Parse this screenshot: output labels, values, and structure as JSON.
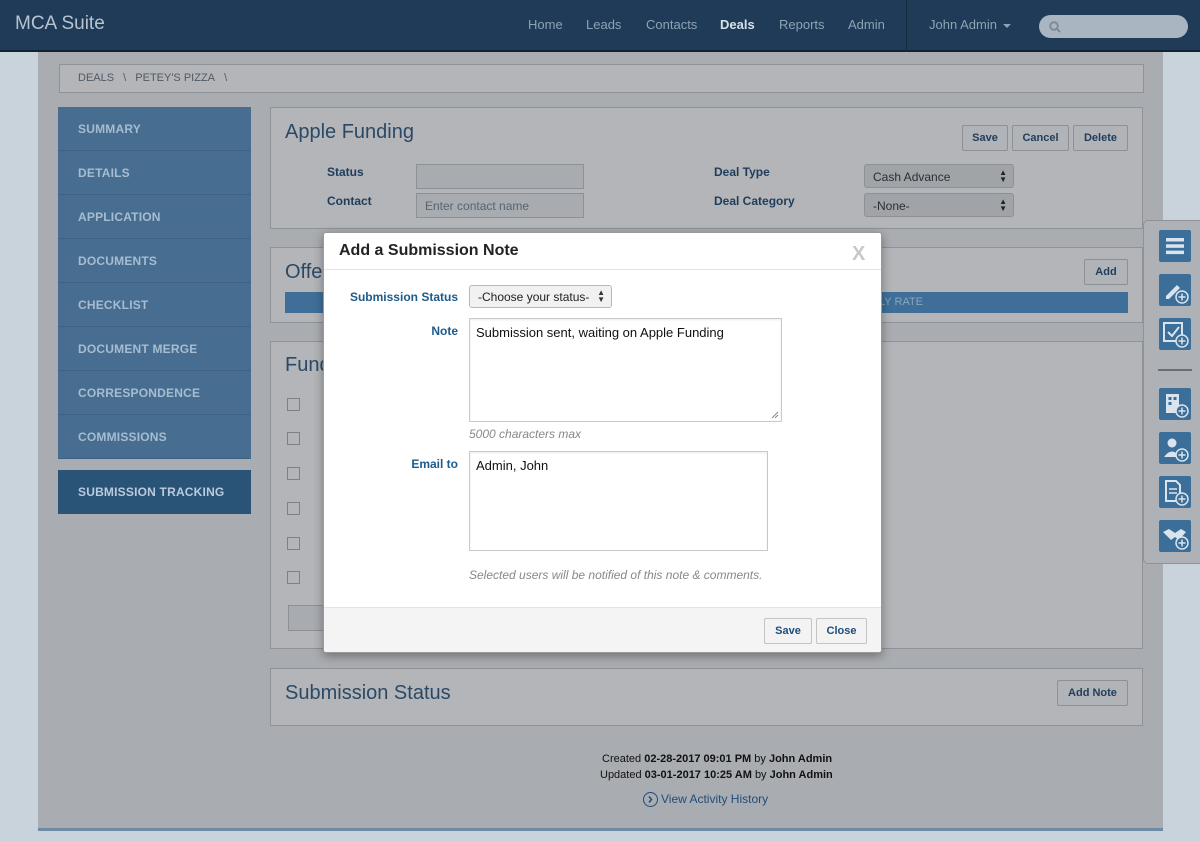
{
  "app": {
    "title": "MCA Suite"
  },
  "nav": {
    "items": [
      "Home",
      "Leads",
      "Contacts",
      "Deals",
      "Reports",
      "Admin"
    ],
    "active": "Deals",
    "user": "John Admin"
  },
  "breadcrumb": [
    "DEALS",
    "\\",
    "PETEY'S PIZZA",
    "\\"
  ],
  "sidebar": {
    "items": [
      "SUMMARY",
      "DETAILS",
      "APPLICATION",
      "DOCUMENTS",
      "CHECKLIST",
      "DOCUMENT MERGE",
      "CORRESPONDENCE",
      "COMMISSIONS"
    ],
    "tracking": "SUBMISSION TRACKING"
  },
  "deal": {
    "title": "Apple Funding",
    "buttons": {
      "save": "Save",
      "cancel": "Cancel",
      "delete": "Delete"
    },
    "status_label": "Status",
    "status_value": "",
    "contact_label": "Contact",
    "contact_placeholder": "Enter contact name",
    "deal_type_label": "Deal Type",
    "deal_type_value": "Cash Advance",
    "deal_category_label": "Deal Category",
    "deal_category_value": "-None-"
  },
  "offers": {
    "title_partial": "Offe",
    "add": "Add",
    "column_partial": "LY RATE"
  },
  "funders": {
    "title_partial": "Fund"
  },
  "submission_status": {
    "title": "Submission Status",
    "add_note": "Add Note"
  },
  "meta": {
    "created_prefix": "Created",
    "created_date": "02-28-2017 09:01 PM",
    "created_by_word": "by",
    "created_by": "John Admin",
    "updated_prefix": "Updated",
    "updated_date": "03-01-2017 10:25 AM",
    "updated_by_word": "by",
    "updated_by": "John Admin",
    "history_link": "View Activity History"
  },
  "modal": {
    "title": "Add a Submission Note",
    "close_x": "X",
    "status_label": "Submission Status",
    "status_value": "-Choose your status-",
    "note_label": "Note",
    "note_value": "Submission sent, waiting on Apple Funding",
    "note_hint": "5000 characters max",
    "email_label": "Email to",
    "email_value": "Admin, John",
    "email_hint": "Selected users will be notified of this note & comments.",
    "save": "Save",
    "close": "Close"
  },
  "rail": {
    "icons": [
      "menu-icon",
      "edit-add-icon",
      "checklist-add-icon",
      "building-add-icon",
      "user-add-icon",
      "document-add-icon",
      "handshake-add-icon"
    ]
  },
  "colors": {
    "navbar": "#1f3b57",
    "sidebar": "#476e91",
    "accent": "#1e4d7b",
    "rail_button": "#3b6e98"
  }
}
